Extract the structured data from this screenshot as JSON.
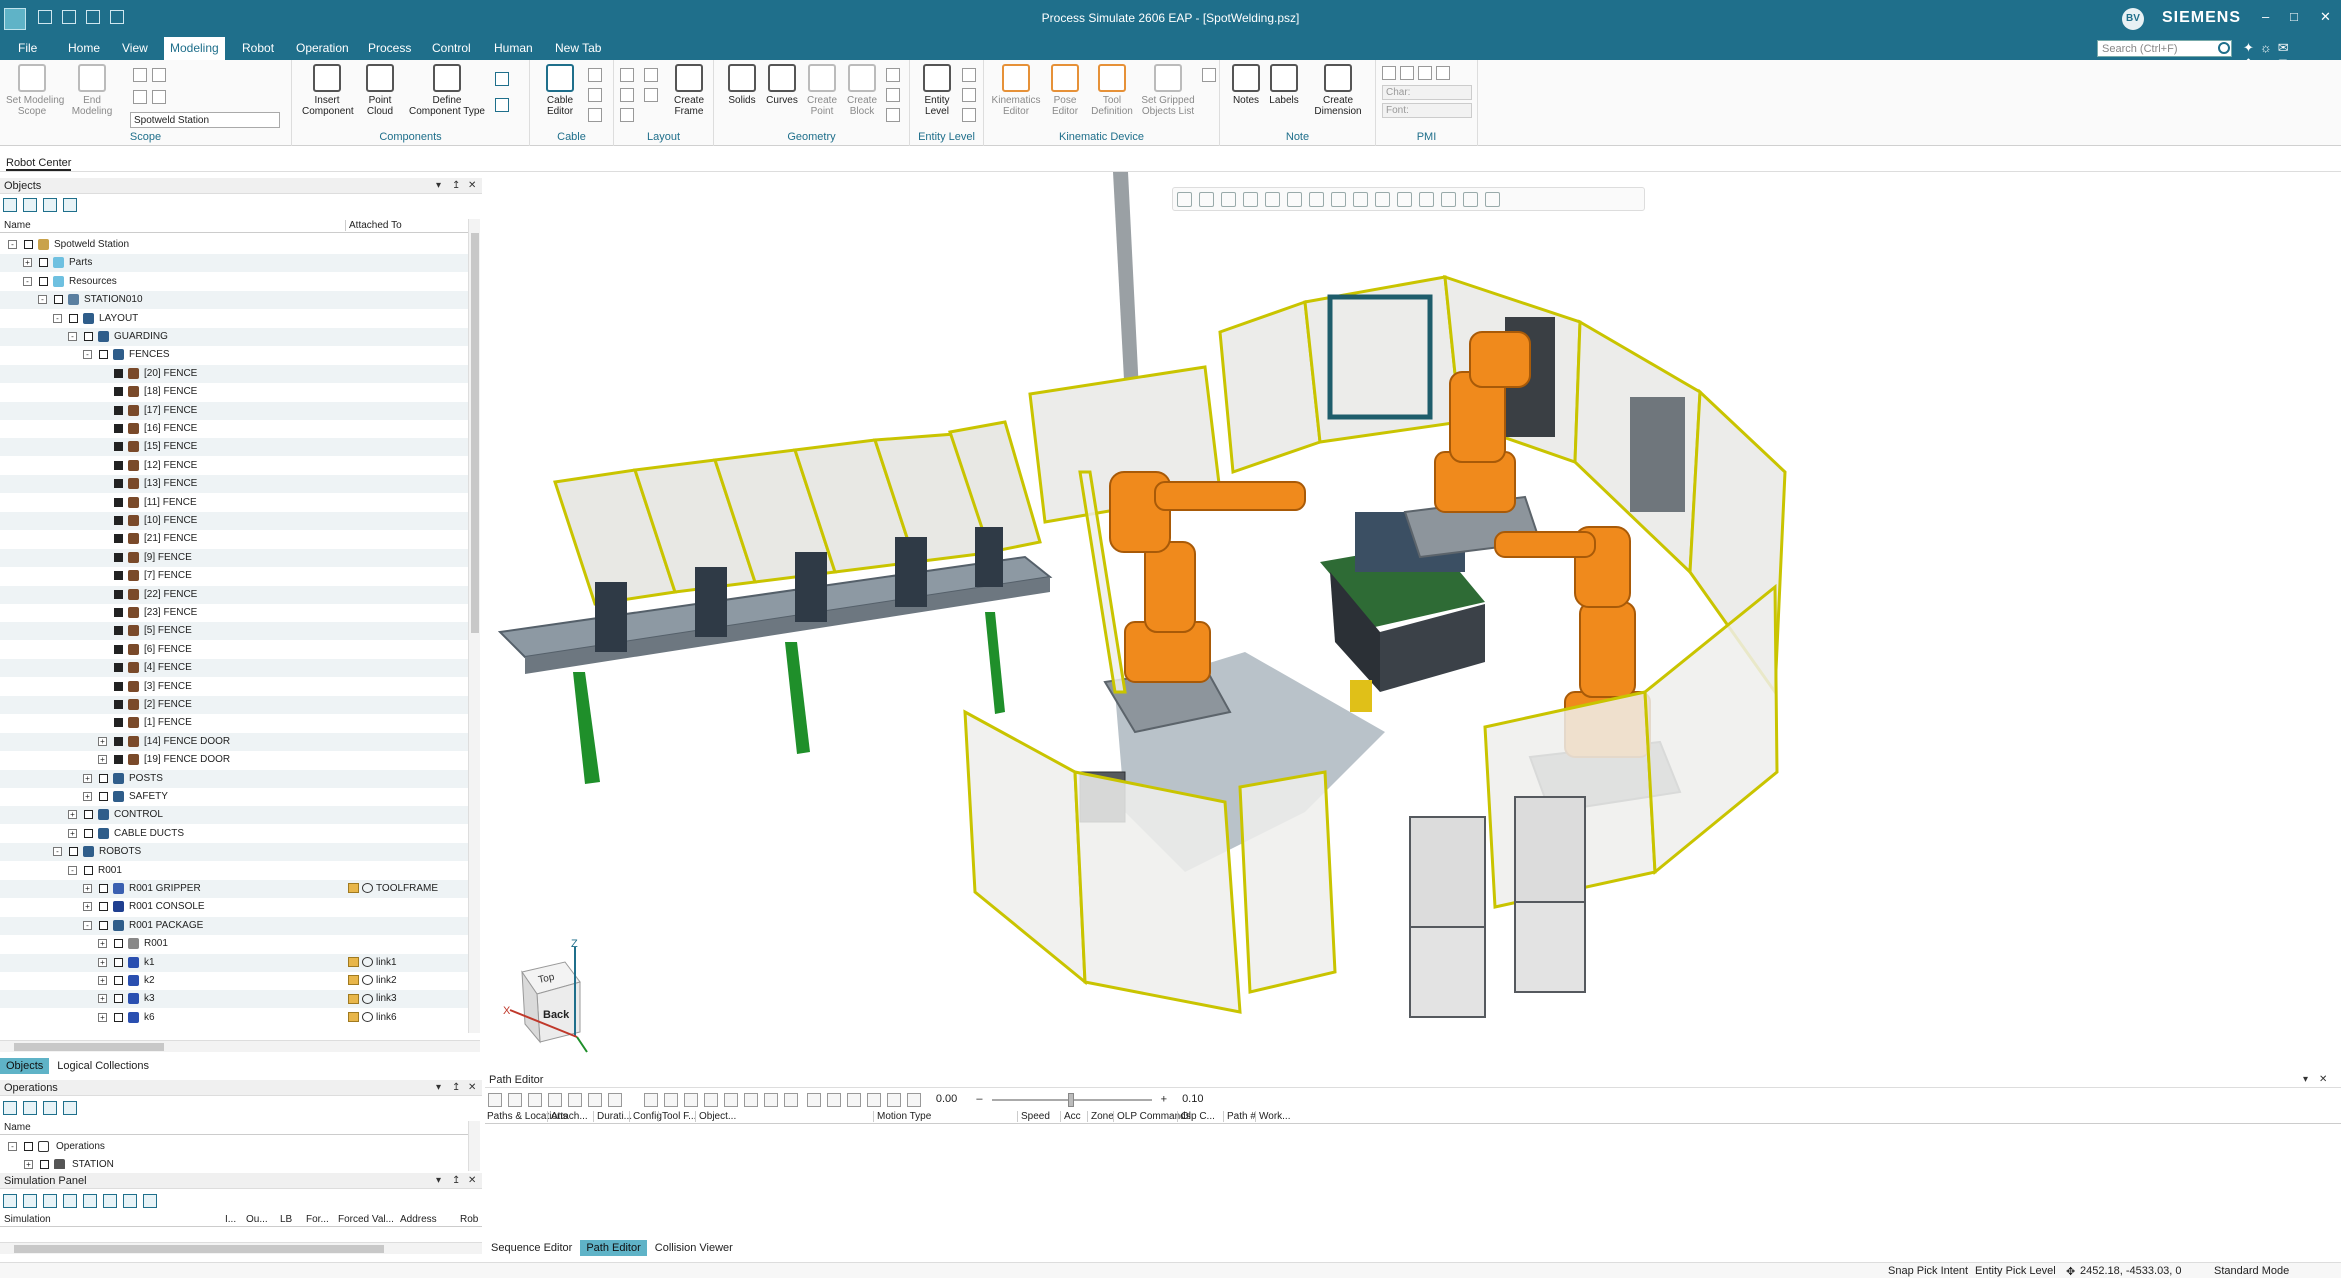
{
  "window": {
    "title": "Process Simulate 2606 EAP - [SpotWelding.psz]",
    "brand": "SIEMENS",
    "user_initials": "BV",
    "search_placeholder": "Search (Ctrl+F)"
  },
  "menu": {
    "tabs": [
      "File",
      "Home",
      "View",
      "Modeling",
      "Robot",
      "Operation",
      "Process",
      "Control",
      "Human",
      "New Tab"
    ],
    "active": "Modeling"
  },
  "ribbon": {
    "scope": {
      "label": "Scope",
      "buttons": [
        "Set Modeling\nScope",
        "End\nModeling"
      ],
      "select_value": "Spotweld Station"
    },
    "components": {
      "label": "Components",
      "buttons": [
        "Insert\nComponent",
        "Point\nCloud",
        "Define\nComponent Type"
      ]
    },
    "cable": {
      "label": "Cable",
      "buttons": [
        "Cable\nEditor"
      ]
    },
    "layout": {
      "label": "Layout",
      "buttons": [
        "Create\nFrame"
      ]
    },
    "geometry": {
      "label": "Geometry",
      "buttons": [
        "Solids",
        "Curves",
        "Create\nPoint",
        "Create\nBlock"
      ]
    },
    "entity_level": {
      "label": "Entity Level",
      "buttons": [
        "Entity\nLevel"
      ]
    },
    "kinematic_device": {
      "label": "Kinematic Device",
      "buttons": [
        "Kinematics\nEditor",
        "Pose\nEditor",
        "Tool\nDefinition",
        "Set Gripped\nObjects List"
      ]
    },
    "note": {
      "label": "Note",
      "buttons": [
        "Notes",
        "Labels",
        "Create\nDimension"
      ]
    },
    "pmi": {
      "label": "PMI",
      "char_placeholder": "Char:",
      "font_placeholder": "Font:"
    }
  },
  "robot_center_tab": "Robot Center",
  "objects_panel": {
    "title": "Objects",
    "columns": [
      "Name",
      "Attached To"
    ],
    "rows": [
      {
        "level": 0,
        "exp": "-",
        "label": "Spotweld Station",
        "icon": "station-folder-icon",
        "attached": ""
      },
      {
        "level": 1,
        "exp": "+",
        "label": "Parts",
        "icon": "folder-icon",
        "attached": ""
      },
      {
        "level": 1,
        "exp": "-",
        "label": "Resources",
        "icon": "folder-icon",
        "attached": ""
      },
      {
        "level": 2,
        "exp": "-",
        "label": "STATION010",
        "icon": "station-icon",
        "attached": ""
      },
      {
        "level": 3,
        "exp": "-",
        "label": "LAYOUT",
        "icon": "compound-icon",
        "attached": ""
      },
      {
        "level": 4,
        "exp": "-",
        "label": "GUARDING",
        "icon": "compound-icon",
        "attached": ""
      },
      {
        "level": 5,
        "exp": "-",
        "label": "FENCES",
        "icon": "compound-icon",
        "attached": ""
      },
      {
        "level": 6,
        "exp": "",
        "label": "[20] FENCE",
        "icon": "resource-icon",
        "attached": ""
      },
      {
        "level": 6,
        "exp": "",
        "label": "[18] FENCE",
        "icon": "resource-icon",
        "attached": ""
      },
      {
        "level": 6,
        "exp": "",
        "label": "[17] FENCE",
        "icon": "resource-icon",
        "attached": ""
      },
      {
        "level": 6,
        "exp": "",
        "label": "[16] FENCE",
        "icon": "resource-icon",
        "attached": ""
      },
      {
        "level": 6,
        "exp": "",
        "label": "[15] FENCE",
        "icon": "resource-icon",
        "attached": ""
      },
      {
        "level": 6,
        "exp": "",
        "label": "[12] FENCE",
        "icon": "resource-icon",
        "attached": ""
      },
      {
        "level": 6,
        "exp": "",
        "label": "[13] FENCE",
        "icon": "resource-icon",
        "attached": ""
      },
      {
        "level": 6,
        "exp": "",
        "label": "[11] FENCE",
        "icon": "resource-icon",
        "attached": ""
      },
      {
        "level": 6,
        "exp": "",
        "label": "[10] FENCE",
        "icon": "resource-icon",
        "attached": ""
      },
      {
        "level": 6,
        "exp": "",
        "label": "[21] FENCE",
        "icon": "resource-icon",
        "attached": ""
      },
      {
        "level": 6,
        "exp": "",
        "label": "[9] FENCE",
        "icon": "resource-icon",
        "attached": ""
      },
      {
        "level": 6,
        "exp": "",
        "label": "[7] FENCE",
        "icon": "resource-icon",
        "attached": ""
      },
      {
        "level": 6,
        "exp": "",
        "label": "[22] FENCE",
        "icon": "resource-icon",
        "attached": ""
      },
      {
        "level": 6,
        "exp": "",
        "label": "[23] FENCE",
        "icon": "resource-icon",
        "attached": ""
      },
      {
        "level": 6,
        "exp": "",
        "label": "[5] FENCE",
        "icon": "resource-icon",
        "attached": ""
      },
      {
        "level": 6,
        "exp": "",
        "label": "[6] FENCE",
        "icon": "resource-icon",
        "attached": ""
      },
      {
        "level": 6,
        "exp": "",
        "label": "[4] FENCE",
        "icon": "resource-icon",
        "attached": ""
      },
      {
        "level": 6,
        "exp": "",
        "label": "[3] FENCE",
        "icon": "resource-icon",
        "attached": ""
      },
      {
        "level": 6,
        "exp": "",
        "label": "[2] FENCE",
        "icon": "resource-icon",
        "attached": ""
      },
      {
        "level": 6,
        "exp": "",
        "label": "[1] FENCE",
        "icon": "resource-icon",
        "attached": ""
      },
      {
        "level": 6,
        "exp": "+",
        "label": "[14] FENCE DOOR",
        "icon": "resource-icon",
        "attached": ""
      },
      {
        "level": 6,
        "exp": "+",
        "label": "[19] FENCE DOOR",
        "icon": "resource-icon",
        "attached": ""
      },
      {
        "level": 5,
        "exp": "+",
        "label": "POSTS",
        "icon": "compound-icon",
        "attached": ""
      },
      {
        "level": 5,
        "exp": "+",
        "label": "SAFETY",
        "icon": "compound-icon",
        "attached": ""
      },
      {
        "level": 4,
        "exp": "+",
        "label": "CONTROL",
        "icon": "compound-icon",
        "attached": ""
      },
      {
        "level": 4,
        "exp": "+",
        "label": "CABLE DUCTS",
        "icon": "compound-icon",
        "attached": ""
      },
      {
        "level": 3,
        "exp": "-",
        "label": "ROBOTS",
        "icon": "compound-icon",
        "attached": ""
      },
      {
        "level": 4,
        "exp": "-",
        "label": "R001",
        "icon": "",
        "attached": ""
      },
      {
        "level": 5,
        "exp": "+",
        "label": "R001 GRIPPER",
        "icon": "gripper-icon",
        "attached": "TOOLFRAME"
      },
      {
        "level": 5,
        "exp": "+",
        "label": "R001 CONSOLE",
        "icon": "console-icon",
        "attached": ""
      },
      {
        "level": 5,
        "exp": "-",
        "label": "R001 PACKAGE",
        "icon": "compound-icon",
        "attached": ""
      },
      {
        "level": 6,
        "exp": "+",
        "label": "R001",
        "icon": "robot-icon",
        "attached": ""
      },
      {
        "level": 6,
        "exp": "+",
        "label": "k1",
        "icon": "link-icon",
        "attached": "link1"
      },
      {
        "level": 6,
        "exp": "+",
        "label": "k2",
        "icon": "link-icon",
        "attached": "link2"
      },
      {
        "level": 6,
        "exp": "+",
        "label": "k3",
        "icon": "link-icon",
        "attached": "link3"
      },
      {
        "level": 6,
        "exp": "+",
        "label": "k6",
        "icon": "link-icon",
        "attached": "link6"
      }
    ],
    "tabs": [
      "Objects",
      "Logical Collections"
    ],
    "active_tab": "Objects"
  },
  "operations_panel": {
    "title": "Operations",
    "column": "Name",
    "rows": [
      "Operations",
      "STATION"
    ]
  },
  "simulation_panel": {
    "title": "Simulation Panel",
    "columns": [
      "Simulation",
      "I...",
      "Ou...",
      "LB",
      "For...",
      "Forced Val...",
      "Address",
      "Rob"
    ]
  },
  "viewport": {
    "cube_face_top": "Top",
    "cube_face_back": "Back",
    "axis_x": "X",
    "axis_z": "Z"
  },
  "path_editor": {
    "title": "Path Editor",
    "time_value": "0.00",
    "step_value": "0.10",
    "columns": [
      "Paths & Locations",
      "Attach...",
      "Durati...",
      "Config",
      "Tool F...",
      "Object...",
      "Motion Type",
      "Speed",
      "Acc",
      "Zone",
      "OLP Commands",
      "Olp C...",
      "Path #",
      "Work..."
    ]
  },
  "bottom_tabs": [
    "Sequence Editor",
    "Path Editor",
    "Collision Viewer"
  ],
  "bottom_active": "Path Editor",
  "status": {
    "snap": "Snap Pick Intent",
    "entity": "Entity Pick Level",
    "coords": "2452.18, -4533.03, 0",
    "mode": "Standard Mode"
  },
  "colors": {
    "titlebar": "#1f6f8b",
    "accent": "#5fb3c7",
    "robot_orange": "#f08a1c",
    "fence_yellow": "#d8d000",
    "conveyor_green": "#1f8f2a"
  }
}
